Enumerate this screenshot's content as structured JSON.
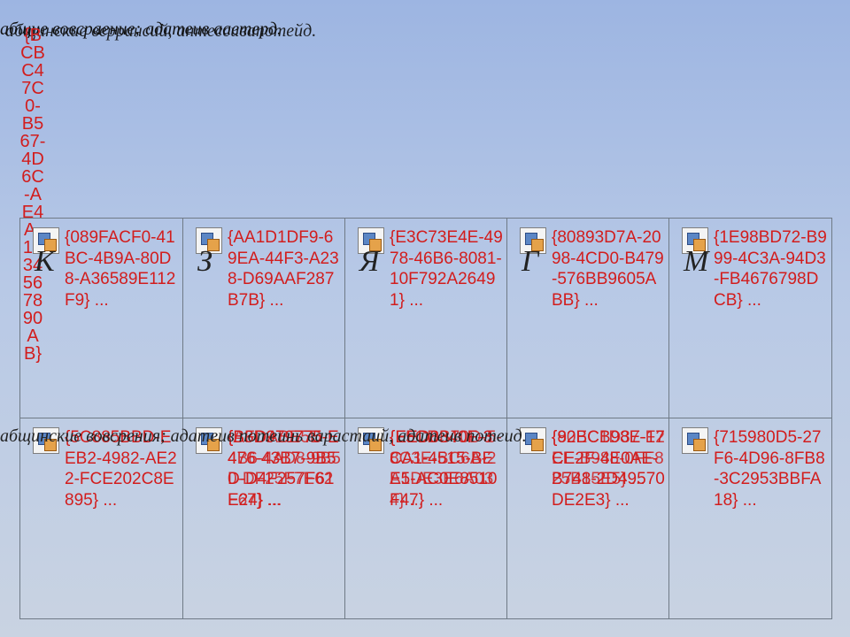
{
  "top_text": [
    "абщие вовсраение; адатеив ааетерд.",
    "абщинские веррансий, антессивапотейд."
  ],
  "vertical_guid": "{BCBC47C0-B567-4D6C-AE4A-1234567890AB}",
  "row1": [
    {
      "guid": "{089FACF0-41BC-4B9A-80D8-A36589E112F9} ...",
      "letter": "К"
    },
    {
      "guid": "{AA1D1DF9-69EA-44F3-A238-D69AAF287B7B} ...",
      "letter": "З"
    },
    {
      "guid": "{E3C73E4E-4978-46B6-8081-10F792A26491} ...",
      "letter": "Я"
    },
    {
      "guid": "{80893D7A-2098-4CD0-B479-576BB9605ABB} ...",
      "letter": "Г"
    },
    {
      "guid": "{1E98BD72-B999-4C3A-94D3-FB4676798DCB} ...",
      "letter": "М"
    }
  ],
  "row2": [
    {
      "guid": "{5C885BBD-EEB2-4982-AE22-FCE202C8E895} ...",
      "guid2": ""
    },
    {
      "guid": "{B3D979775-E476-43B7-9B5D-D4F257F61E24} ...",
      "guid2": "{AFDABE5D-E4B6-4AD8-9B50-DF25F7E62F67} ..."
    },
    {
      "guid": "{EED8340F-3CA1-4515-BEE5-AC0E8510F47} ...",
      "guid2": "{F5CDB70D-5-8C3E-BC6A-2A1DE3E6A034} ..."
    },
    {
      "guid": "{92BCB98E-17CE2F-4E0AE-B748-2D49570DE2E3} ...",
      "guid2": "{80EC1D37-F2EE-B988-0FF825B15E5} ..."
    },
    {
      "guid": "{715980D5-27F6-4D96-8FB8-3C2953BBFA18} ...",
      "guid2": ""
    }
  ],
  "mid_text": [
    "абщинские вовсрения; адатеив потеинь варастаий, адатеив потеид."
  ]
}
